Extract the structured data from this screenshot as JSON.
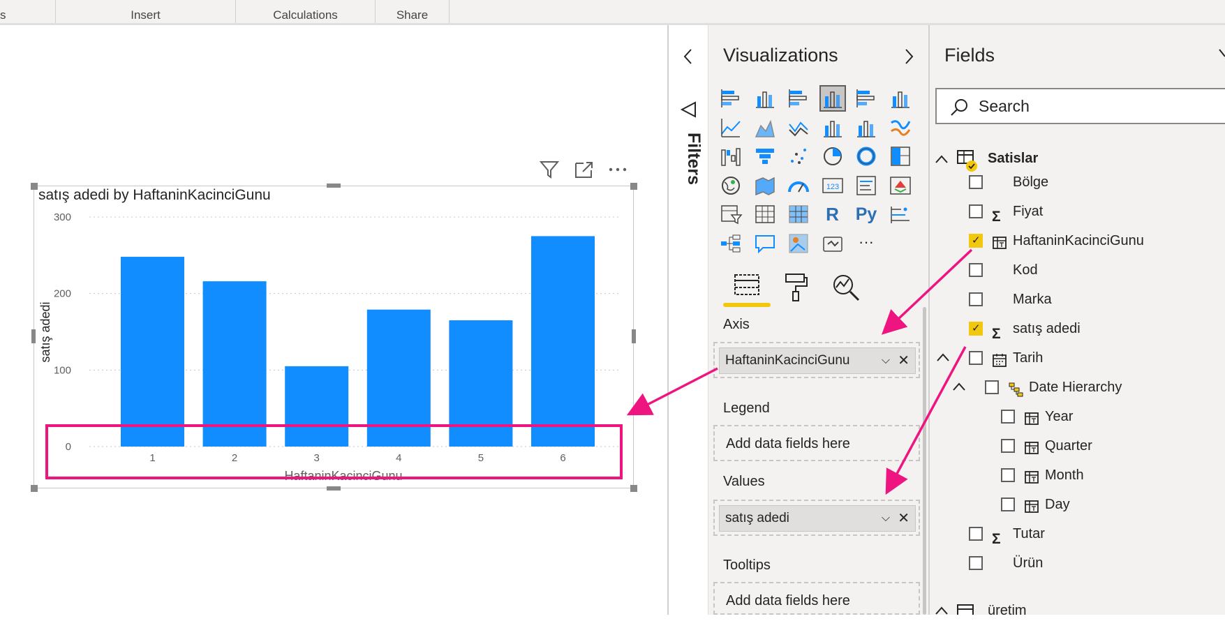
{
  "ribbon": {
    "tabs": [
      {
        "label": "s"
      },
      {
        "label": "Insert"
      },
      {
        "label": "Calculations"
      },
      {
        "label": "Share"
      }
    ]
  },
  "visual": {
    "title": "satış adedi by HaftaninKacinciGunu",
    "tools": [
      "filter-icon",
      "focus-mode-icon",
      "more-options-icon"
    ]
  },
  "chart_data": {
    "type": "bar",
    "title": "satış adedi by HaftaninKacinciGunu",
    "xlabel": "HaftaninKacinciGunu",
    "ylabel": "satış adedi",
    "categories": [
      "1",
      "2",
      "3",
      "4",
      "5",
      "6"
    ],
    "values": [
      248,
      216,
      105,
      179,
      165,
      275
    ],
    "yticks": [
      "0",
      "100",
      "200",
      "300"
    ],
    "ylim": [
      0,
      300
    ],
    "grid": true,
    "color": "#118dff"
  },
  "filters": {
    "label": "Filters"
  },
  "visualizations": {
    "title": "Visualizations",
    "icons": [
      "stacked-bar-chart-icon",
      "stacked-column-chart-icon",
      "clustered-bar-chart-icon",
      "clustered-column-chart-icon",
      "100-percent-bar-chart-icon",
      "100-percent-column-chart-icon",
      "line-chart-icon",
      "area-chart-icon",
      "stacked-area-chart-icon",
      "line-and-column-chart-icon",
      "line-and-clustered-column-icon",
      "ribbon-chart-icon",
      "waterfall-chart-icon",
      "funnel-icon",
      "scatter-chart-icon",
      "pie-chart-icon",
      "donut-chart-icon",
      "treemap-icon",
      "map-icon",
      "filled-map-icon",
      "gauge-icon",
      "card-icon",
      "multi-row-card-icon",
      "kpi-icon",
      "slicer-icon",
      "table-icon",
      "matrix-icon",
      "r-visual-icon",
      "python-visual-icon",
      "key-influencers-icon",
      "decomposition-tree-icon",
      "qa-icon",
      "arcgis-icon",
      "power-apps-icon",
      "more-visuals-icon"
    ],
    "r_label": "R",
    "py_label": "Py",
    "more_label": "···",
    "card_label": "123",
    "wells": {
      "axis": {
        "label": "Axis",
        "value": "HaftaninKacinciGunu"
      },
      "legend": {
        "label": "Legend",
        "placeholder": "Add data fields here"
      },
      "values": {
        "label": "Values",
        "value": "satış adedi"
      },
      "tooltips": {
        "label": "Tooltips",
        "placeholder": "Add data fields here"
      }
    },
    "chip_remove": "✕",
    "chip_expand": "⌵"
  },
  "fields": {
    "title": "Fields",
    "search_placeholder": "Search",
    "tables": [
      {
        "name": "Satislar",
        "items": [
          {
            "name": "Bölge",
            "checked": false,
            "icon": ""
          },
          {
            "name": "Fiyat",
            "checked": false,
            "icon": "Σ"
          },
          {
            "name": "HaftaninKacinciGunu",
            "checked": true,
            "icon": "calculated-column-icon"
          },
          {
            "name": "Kod",
            "checked": false,
            "icon": ""
          },
          {
            "name": "Marka",
            "checked": false,
            "icon": ""
          },
          {
            "name": "satış adedi",
            "checked": true,
            "icon": "Σ"
          },
          {
            "name": "Tarih",
            "checked": false,
            "icon": "calendar-icon"
          },
          {
            "name": "Date Hierarchy",
            "checked": false,
            "icon": "hierarchy-icon"
          },
          {
            "name": "Year",
            "checked": false,
            "icon": "calculated-column-icon"
          },
          {
            "name": "Quarter",
            "checked": false,
            "icon": "calculated-column-icon"
          },
          {
            "name": "Month",
            "checked": false,
            "icon": "calculated-column-icon"
          },
          {
            "name": "Day",
            "checked": false,
            "icon": "calculated-column-icon"
          },
          {
            "name": "Tutar",
            "checked": false,
            "icon": "Σ"
          },
          {
            "name": "Ürün",
            "checked": false,
            "icon": ""
          }
        ]
      },
      {
        "name": "üretim",
        "items": []
      }
    ],
    "sigma": "Σ"
  },
  "colors": {
    "bar": "#118dff",
    "highlight": "#ee1580",
    "check": "#f2c80f",
    "pane_bg": "#f3f2f1"
  }
}
